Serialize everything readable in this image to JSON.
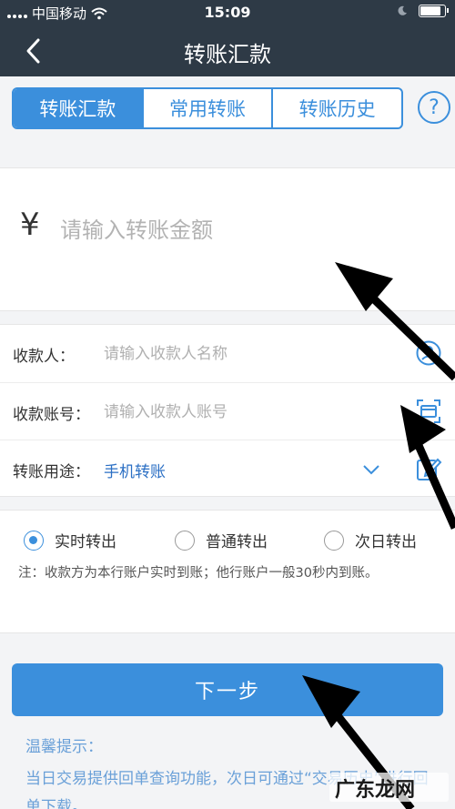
{
  "status_bar": {
    "carrier": "中国移动",
    "time": "15:09",
    "battery_level": 0.92
  },
  "nav": {
    "title": "转账汇款"
  },
  "tabs": [
    {
      "label": "转账汇款",
      "active": true
    },
    {
      "label": "常用转账",
      "active": false
    },
    {
      "label": "转账历史",
      "active": false
    }
  ],
  "help": {
    "label": "?"
  },
  "amount": {
    "currency_symbol": "¥",
    "placeholder": "请输入转账金额"
  },
  "form": {
    "payee": {
      "label": "收款人：",
      "placeholder": "请输入收款人名称"
    },
    "account": {
      "label": "收款账号：",
      "placeholder": "请输入收款人账号"
    },
    "purpose": {
      "label": "转账用途：",
      "value": "手机转账"
    }
  },
  "transfer_mode": {
    "options": [
      {
        "label": "实时转出",
        "selected": true
      },
      {
        "label": "普通转出",
        "selected": false
      },
      {
        "label": "次日转出",
        "selected": false
      }
    ],
    "note": "注：收款方为本行账户实时到账；他行账户一般30秒内到账。"
  },
  "next_button": {
    "label": "下一步"
  },
  "tips": {
    "title": "温馨提示：",
    "body": "当日交易提供回单查询功能，次日可通过“交易历史”进行回单下载。"
  },
  "watermark": {
    "text": "广东龙网"
  },
  "colors": {
    "primary": "#3b8fdc",
    "header_bg": "#2e3a46",
    "tip_text": "#6aa0d8"
  }
}
